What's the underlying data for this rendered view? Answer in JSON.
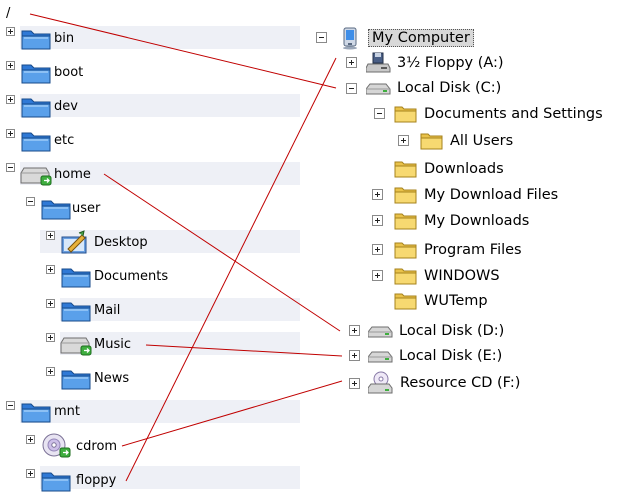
{
  "left_tree": {
    "root_label": "/",
    "items": [
      {
        "label": "bin",
        "icon": "folder-icon",
        "expander": "plus"
      },
      {
        "label": "boot",
        "icon": "folder-icon",
        "expander": "plus"
      },
      {
        "label": "dev",
        "icon": "folder-icon",
        "expander": "plus"
      },
      {
        "label": "etc",
        "icon": "folder-icon",
        "expander": "plus"
      },
      {
        "label": "home",
        "icon": "drive-icon",
        "expander": "minus"
      },
      {
        "label": "user",
        "icon": "folder-icon",
        "expander": "minus"
      },
      {
        "label": "Desktop",
        "icon": "desktop-icon",
        "expander": "plus"
      },
      {
        "label": "Documents",
        "icon": "folder-icon",
        "expander": "plus"
      },
      {
        "label": "Mail",
        "icon": "folder-icon",
        "expander": "plus"
      },
      {
        "label": "Music",
        "icon": "drive-icon",
        "expander": "plus"
      },
      {
        "label": "News",
        "icon": "folder-icon",
        "expander": "plus"
      },
      {
        "label": "mnt",
        "icon": "folder-icon",
        "expander": "minus"
      },
      {
        "label": "cdrom",
        "icon": "cdrom-icon",
        "expander": "plus"
      },
      {
        "label": "floppy",
        "icon": "folder-icon",
        "expander": "plus"
      }
    ]
  },
  "right_tree": {
    "items": [
      {
        "label": "My Computer",
        "icon": "computer-icon",
        "expander": "minus"
      },
      {
        "label": "3½ Floppy (A:)",
        "icon": "floppy-drive-icon",
        "expander": "plus"
      },
      {
        "label": "Local Disk (C:)",
        "icon": "hard-disk-icon",
        "expander": "minus"
      },
      {
        "label": "Documents and Settings",
        "icon": "folder-icon",
        "expander": "minus"
      },
      {
        "label": "All Users",
        "icon": "folder-icon",
        "expander": "plus"
      },
      {
        "label": "Downloads",
        "icon": "folder-icon",
        "expander": "none"
      },
      {
        "label": "My Download Files",
        "icon": "folder-icon",
        "expander": "plus"
      },
      {
        "label": "My Downloads",
        "icon": "folder-icon",
        "expander": "plus"
      },
      {
        "label": "Program Files",
        "icon": "folder-icon",
        "expander": "plus"
      },
      {
        "label": "WINDOWS",
        "icon": "folder-icon",
        "expander": "plus"
      },
      {
        "label": "WUTemp",
        "icon": "folder-icon",
        "expander": "none"
      },
      {
        "label": "Local Disk (D:)",
        "icon": "hard-disk-icon",
        "expander": "plus"
      },
      {
        "label": "Local Disk (E:)",
        "icon": "hard-disk-icon",
        "expander": "plus"
      },
      {
        "label": "Resource CD (F:)",
        "icon": "cd-drive-icon",
        "expander": "plus"
      }
    ]
  },
  "connectors": [
    {
      "from": "/",
      "to": "Local Disk (C:)"
    },
    {
      "from": "home",
      "to": "Local Disk (D:)"
    },
    {
      "from": "Music",
      "to": "Local Disk (E:)"
    },
    {
      "from": "cdrom",
      "to": "Resource CD (F:)"
    },
    {
      "from": "floppy",
      "to": "3½ Floppy (A:)"
    }
  ],
  "colors": {
    "connector": "#c00000",
    "row_stripe": "#eef0f6",
    "xp_folder": "#f5d469",
    "linux_folder": "#2f79d6"
  }
}
